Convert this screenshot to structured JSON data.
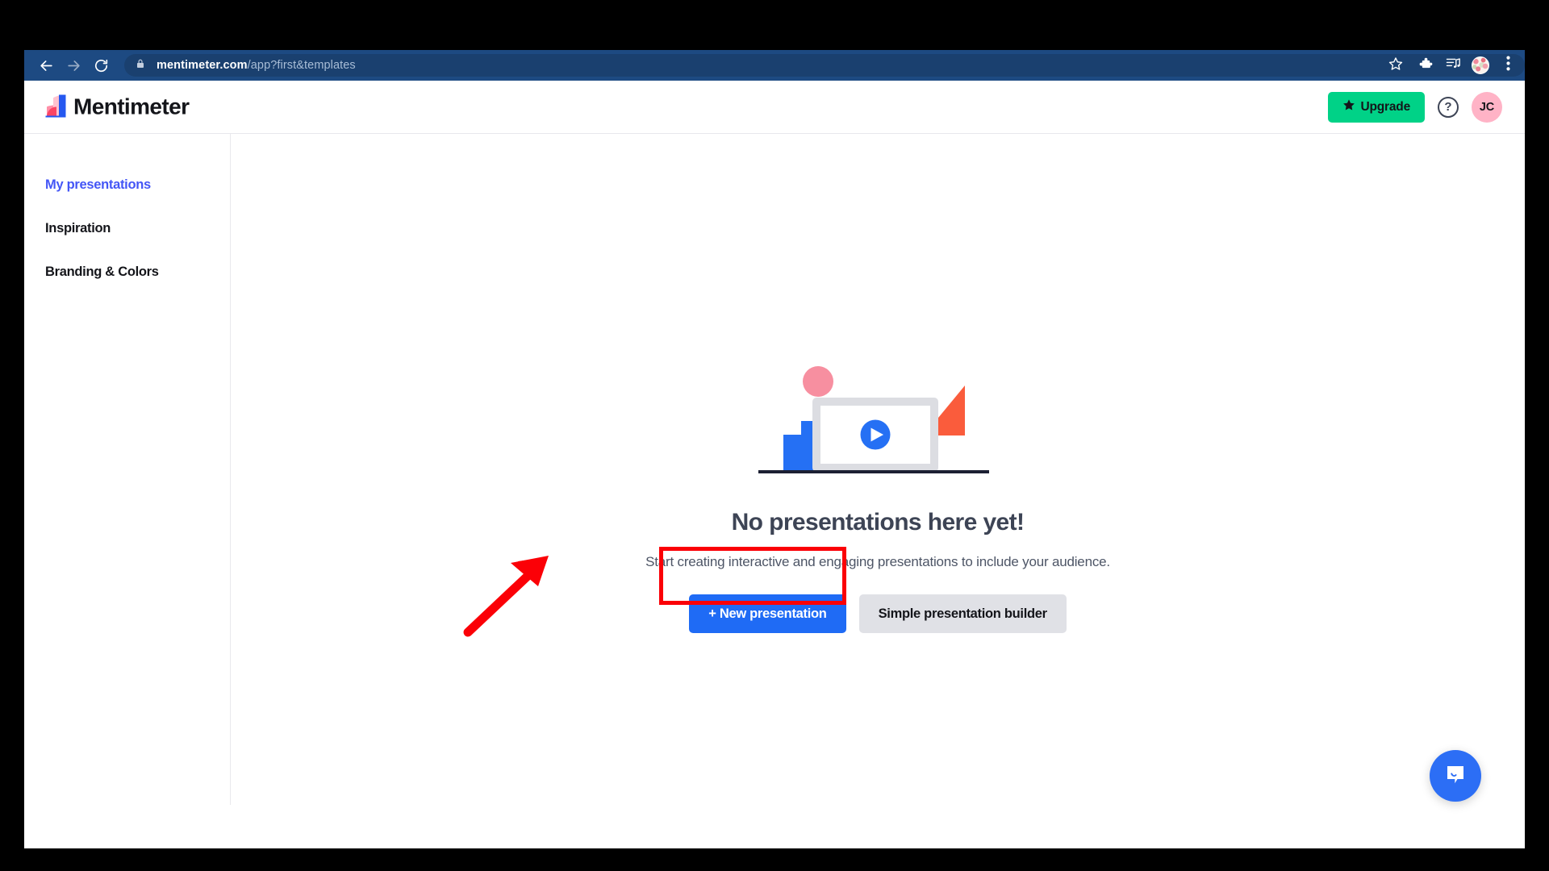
{
  "browser": {
    "back_icon": "arrow-left-icon",
    "forward_icon": "arrow-right-icon",
    "reload_icon": "reload-icon",
    "lock_icon": "lock-icon",
    "url_host": "mentimeter.com",
    "url_path": "/app?first&templates",
    "star_icon": "star-outline-icon",
    "extensions_icon": "puzzle-piece-icon",
    "media_icon": "media-playlist-icon",
    "profile_icon": "profile-avatar-icon",
    "menu_icon": "three-dot-menu-icon",
    "chrome_bar_color": "#1d4a82"
  },
  "header": {
    "brand_name": "Mentimeter",
    "brand_logo_icon": "mentimeter-bars-logo",
    "upgrade_label": "Upgrade",
    "upgrade_star_icon": "star-filled-icon",
    "upgrade_color": "#00d287",
    "help_label": "?",
    "help_icon": "question-mark-circle-icon",
    "avatar_initials": "JC",
    "avatar_color": "#ffb3c6"
  },
  "sidebar": {
    "items": [
      {
        "label": "My presentations",
        "active": true
      },
      {
        "label": "Inspiration",
        "active": false
      },
      {
        "label": "Branding & Colors",
        "active": false
      }
    ],
    "active_color": "#4456f6"
  },
  "main": {
    "illustration_icon": "presentation-video-illustration",
    "empty_title": "No presentations here yet!",
    "empty_subtitle": "Start creating interactive and engaging presentations to include your audience.",
    "primary_cta_label": "+ New presentation",
    "primary_cta_color": "#1f6bf5",
    "secondary_cta_label": "Simple presentation builder",
    "secondary_cta_color": "#e0e1e6"
  },
  "annotation": {
    "highlight_color": "#fb0007",
    "arrow_icon": "red-pointer-arrow-icon",
    "highlight_target": "+ New presentation"
  },
  "chat": {
    "launcher_icon": "chat-bubble-smile-icon",
    "launcher_color": "#2c6ef5"
  }
}
